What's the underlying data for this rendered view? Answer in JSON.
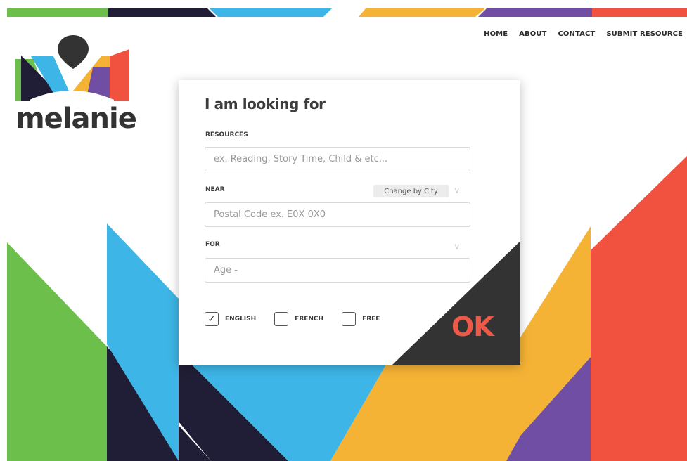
{
  "brand": {
    "name": "melanie",
    "colors": {
      "green": "#6cbf4b",
      "navy": "#201d36",
      "blue": "#3db5e6",
      "yellow": "#f5b335",
      "purple": "#6f4ea3",
      "red": "#f0523f",
      "dark": "#333333",
      "accent_ok": "#ef5a48"
    }
  },
  "nav": {
    "items": [
      {
        "label": "HOME"
      },
      {
        "label": "ABOUT"
      },
      {
        "label": "CONTACT"
      },
      {
        "label": "SUBMIT RESOURCE"
      }
    ]
  },
  "search": {
    "title": "I am looking for",
    "resources": {
      "label": "RESOURCES",
      "placeholder": "ex. Reading, Story Time, Child & etc..."
    },
    "near": {
      "label": "NEAR",
      "change_by_city": "Change by City",
      "placeholder": "Postal Code ex. E0X 0X0"
    },
    "for": {
      "label": "FOR",
      "age_selected": "Age -"
    },
    "options": [
      {
        "label": "ENGLISH",
        "checked": true
      },
      {
        "label": "FRENCH",
        "checked": false
      },
      {
        "label": "FREE",
        "checked": false
      }
    ],
    "submit_label": "OK"
  }
}
